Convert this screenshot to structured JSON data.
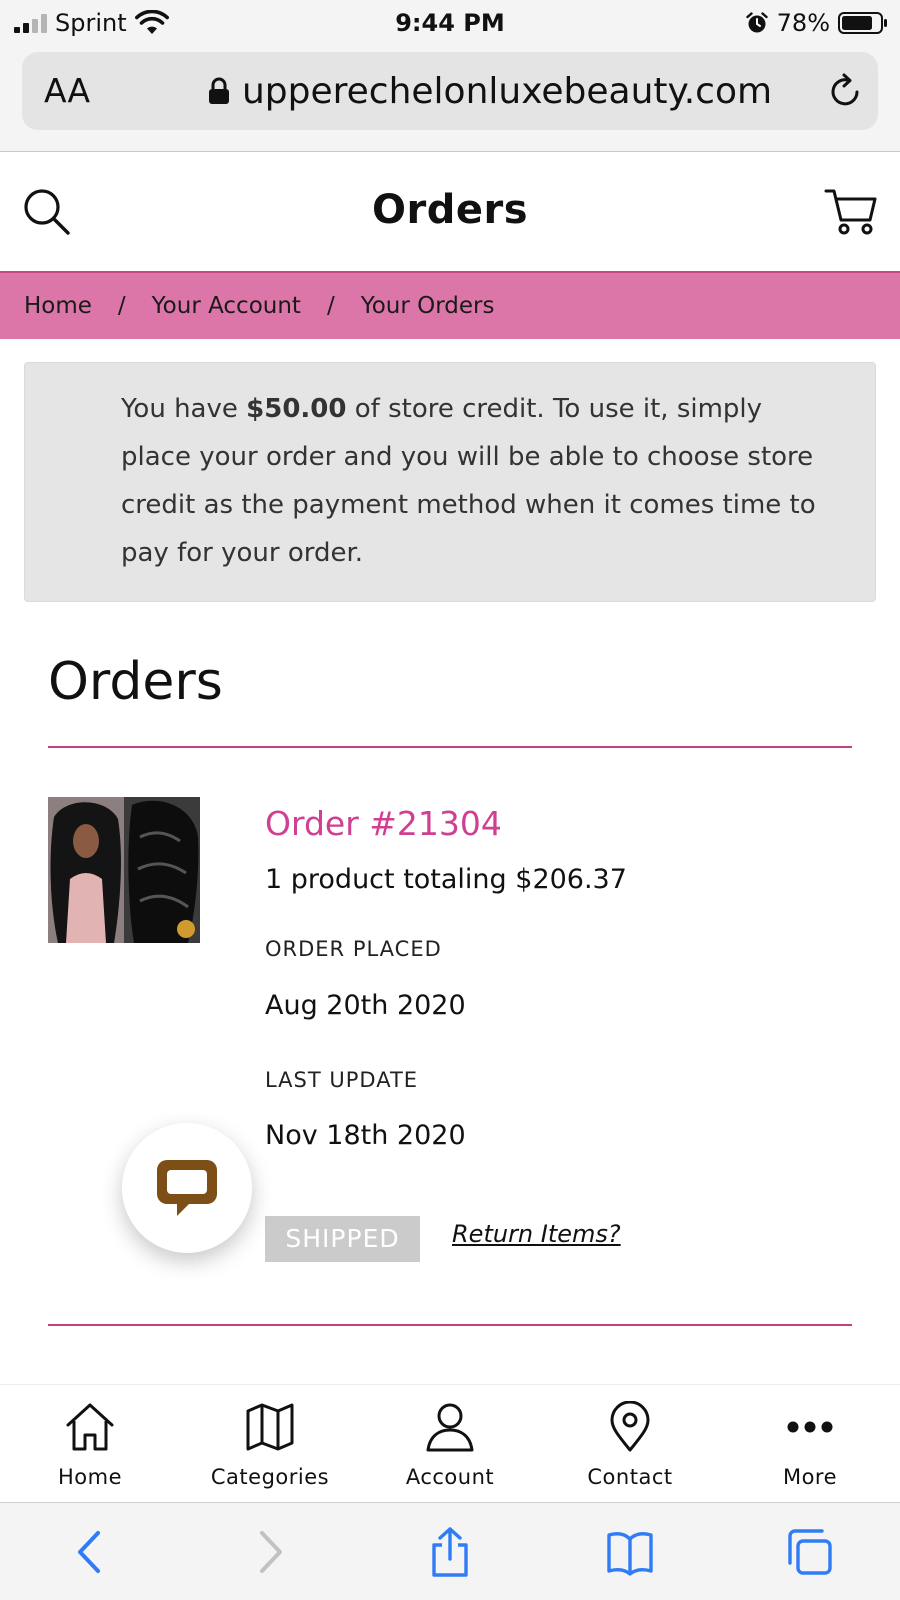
{
  "status_bar": {
    "carrier": "Sprint",
    "time": "9:44 PM",
    "battery": "78%"
  },
  "browser": {
    "text_size_label": "AA",
    "url": "upperechelonluxebeauty.com"
  },
  "header": {
    "title": "Orders"
  },
  "breadcrumb": {
    "items": [
      "Home",
      "Your Account",
      "Your Orders"
    ],
    "separator": "/"
  },
  "store_credit": {
    "prefix": "You have ",
    "amount": "$50.00",
    "suffix": " of store credit. To use it, simply place your order and you will be able to choose store credit as the payment method when it comes time to pay for your order."
  },
  "orders": {
    "heading": "Orders",
    "list": [
      {
        "order_number": "Order #21304",
        "summary": "1 product totaling $206.37",
        "placed_label": "ORDER PLACED",
        "placed_date": "Aug 20th 2020",
        "update_label": "LAST UPDATE",
        "update_date": "Nov 18th 2020",
        "status": "SHIPPED",
        "return_label": "Return Items?"
      }
    ]
  },
  "site_nav": {
    "items": [
      {
        "label": "Home",
        "icon": "home-icon"
      },
      {
        "label": "Categories",
        "icon": "map-icon"
      },
      {
        "label": "Account",
        "icon": "user-icon"
      },
      {
        "label": "Contact",
        "icon": "location-pin-icon"
      },
      {
        "label": "More",
        "icon": "more-dots-icon"
      }
    ]
  },
  "browser_toolbar": {
    "items": [
      {
        "icon": "back-icon",
        "enabled": true
      },
      {
        "icon": "forward-icon",
        "enabled": false
      },
      {
        "icon": "share-icon",
        "enabled": true
      },
      {
        "icon": "bookmarks-icon",
        "enabled": true
      },
      {
        "icon": "tabs-icon",
        "enabled": true
      }
    ]
  },
  "colors": {
    "accent_pink": "#cf3f92",
    "breadcrumb_bg": "#dc76a8",
    "ios_blue": "#2f7cf6",
    "chat_brown": "#7d4f16"
  }
}
